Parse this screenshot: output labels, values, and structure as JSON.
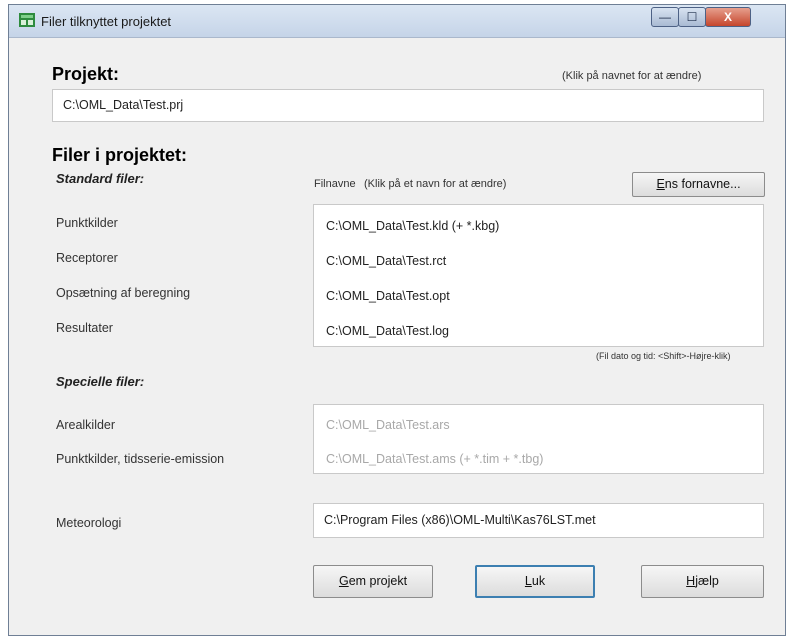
{
  "window": {
    "title": "Filer tilknyttet projektet",
    "minimize_glyph": "—",
    "maximize_glyph": "☐",
    "close_glyph": "X",
    "icon": "app-icon"
  },
  "project": {
    "heading": "Projekt:",
    "hint": "(Klik på navnet for at ændre)",
    "path": "C:\\OML_Data\\Test.prj"
  },
  "files": {
    "heading": "Filer i projektet:",
    "standard_heading": "Standard filer:",
    "filenames_label": "Filnavne",
    "filenames_hint": "(Klik på et navn for at ændre)",
    "same_name_button_prefix": "E",
    "same_name_button_rest": "ns fornavne...",
    "standard": [
      {
        "label": "Punktkilder",
        "file": "C:\\OML_Data\\Test.kld  (+ *.kbg)"
      },
      {
        "label": "Receptorer",
        "file": "C:\\OML_Data\\Test.rct"
      },
      {
        "label": "Opsætning af beregning",
        "file": "C:\\OML_Data\\Test.opt"
      },
      {
        "label": "Resultater",
        "file": "C:\\OML_Data\\Test.log"
      }
    ],
    "date_hint": "(Fil dato og tid: <Shift>-Højre-klik)",
    "special_heading": "Specielle filer:",
    "special": [
      {
        "label": "Arealkilder",
        "file": "C:\\OML_Data\\Test.ars"
      },
      {
        "label": "Punktkilder, tidsserie-emission",
        "file": "C:\\OML_Data\\Test.ams  (+ *.tim + *.tbg)"
      }
    ],
    "meteo_label": "Meteorologi",
    "meteo_file": "C:\\Program Files (x86)\\OML-Multi\\Kas76LST.met"
  },
  "buttons": {
    "save_prefix": "G",
    "save_rest": "em projekt",
    "close_prefix": "L",
    "close_rest": "uk",
    "help_prefix": "H",
    "help_rest": "jælp"
  }
}
